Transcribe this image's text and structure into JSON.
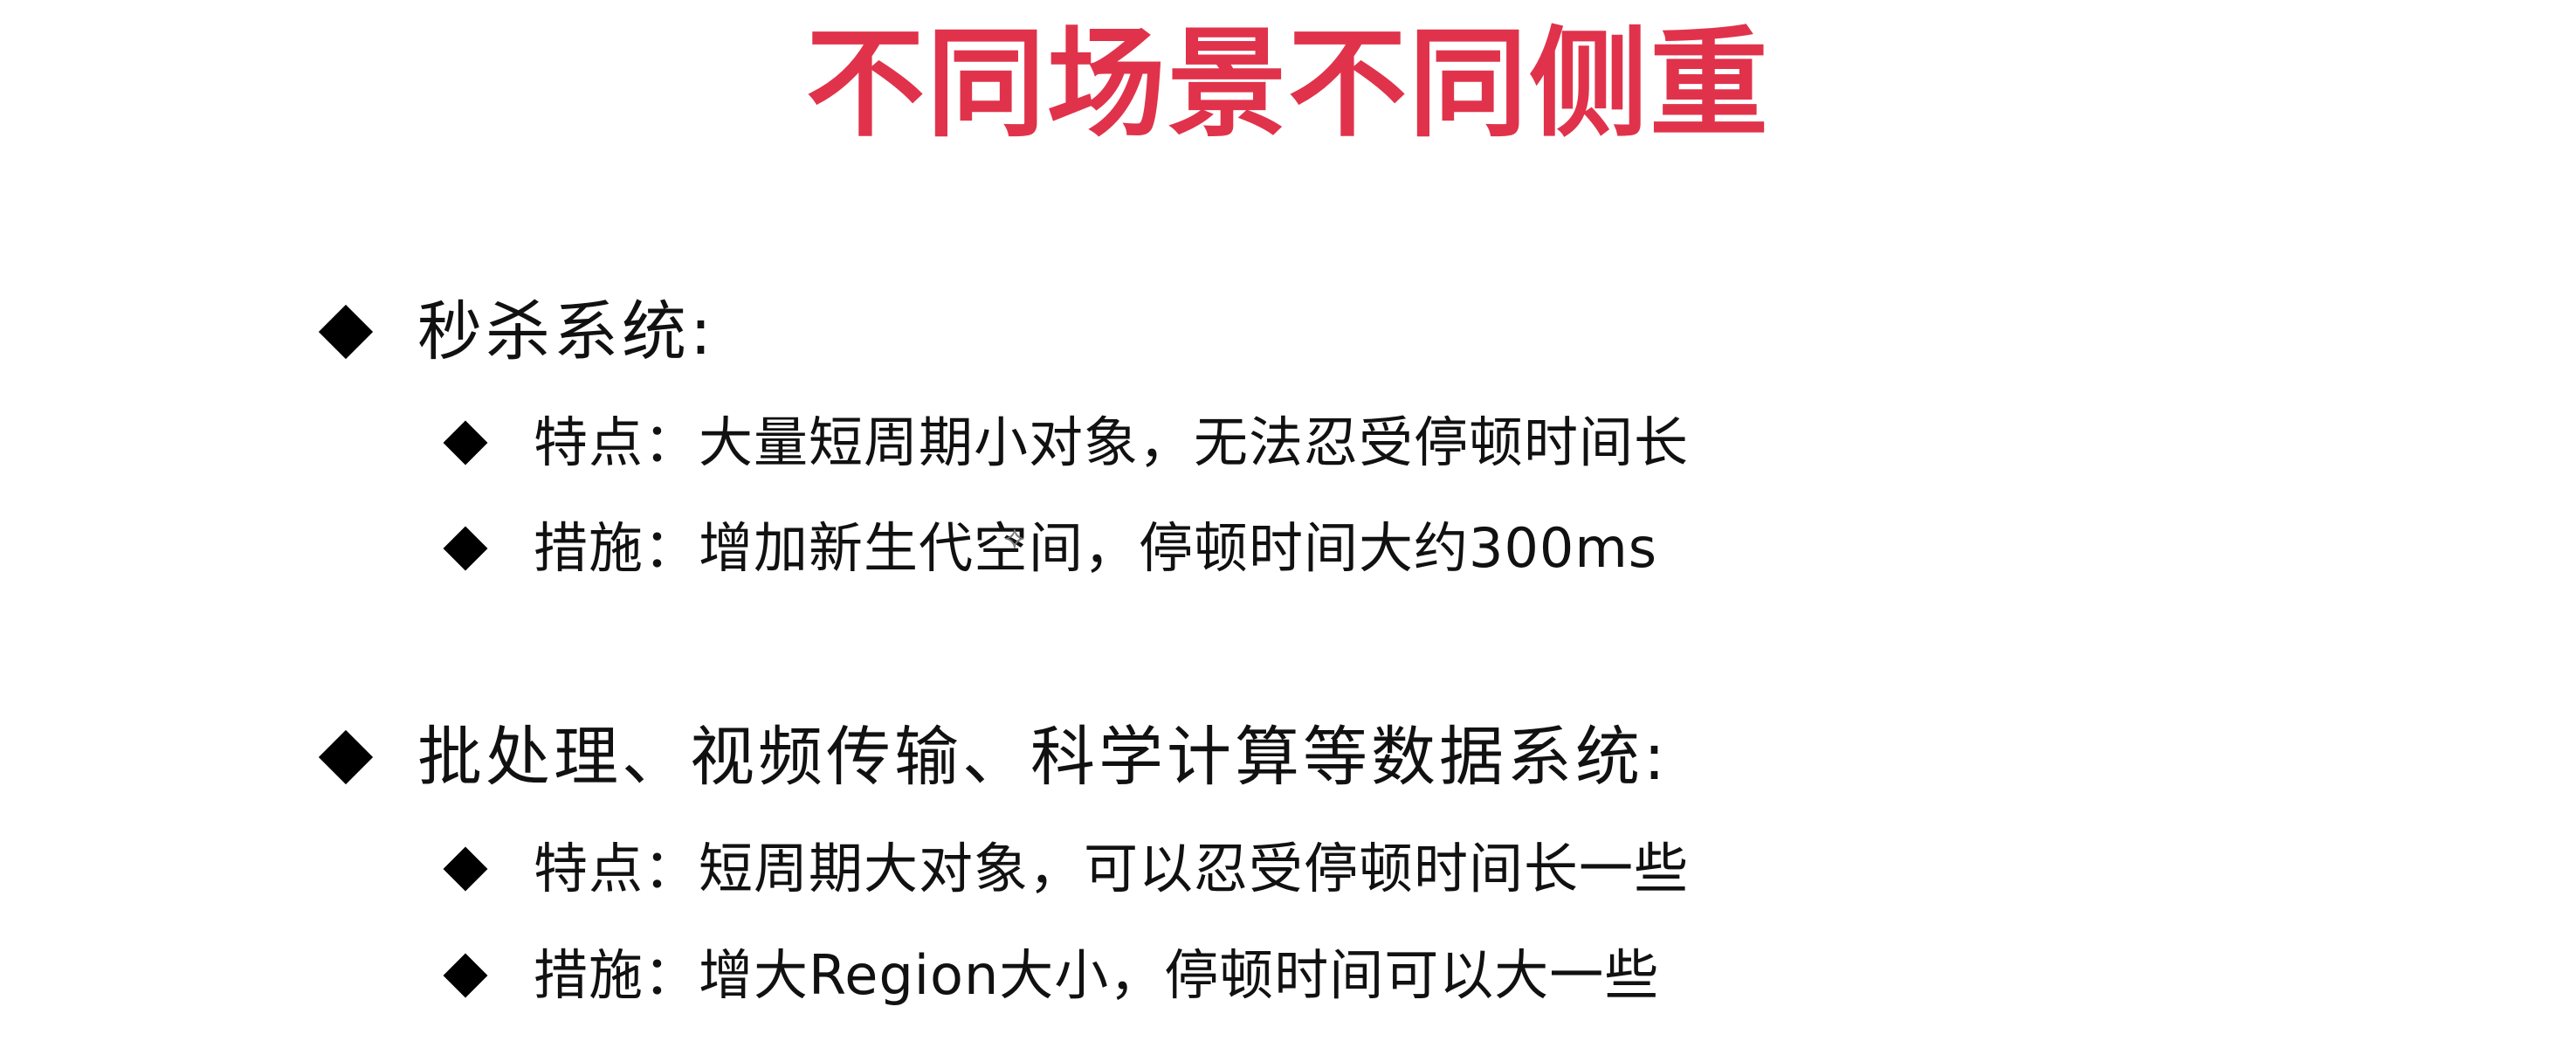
{
  "slide": {
    "title": "不同场景不同侧重",
    "sections": [
      {
        "heading": "秒杀系统:",
        "items": [
          "特点：大量短周期小对象，无法忍受停顿时间长",
          "措施：增加新生代空间，停顿时间大约300ms"
        ]
      },
      {
        "heading": "批处理、视频传输、科学计算等数据系统:",
        "items": [
          "特点：短周期大对象，可以忍受停顿时间长一些",
          "措施：增大Region大小，停顿时间可以大一些"
        ]
      }
    ]
  },
  "colors": {
    "title": "#e0334b",
    "text": "#111111",
    "bullet": "#000000",
    "background": "#ffffff"
  },
  "icons": {
    "bullet": "diamond-bullet-icon",
    "cursor": "cursor-icon"
  }
}
